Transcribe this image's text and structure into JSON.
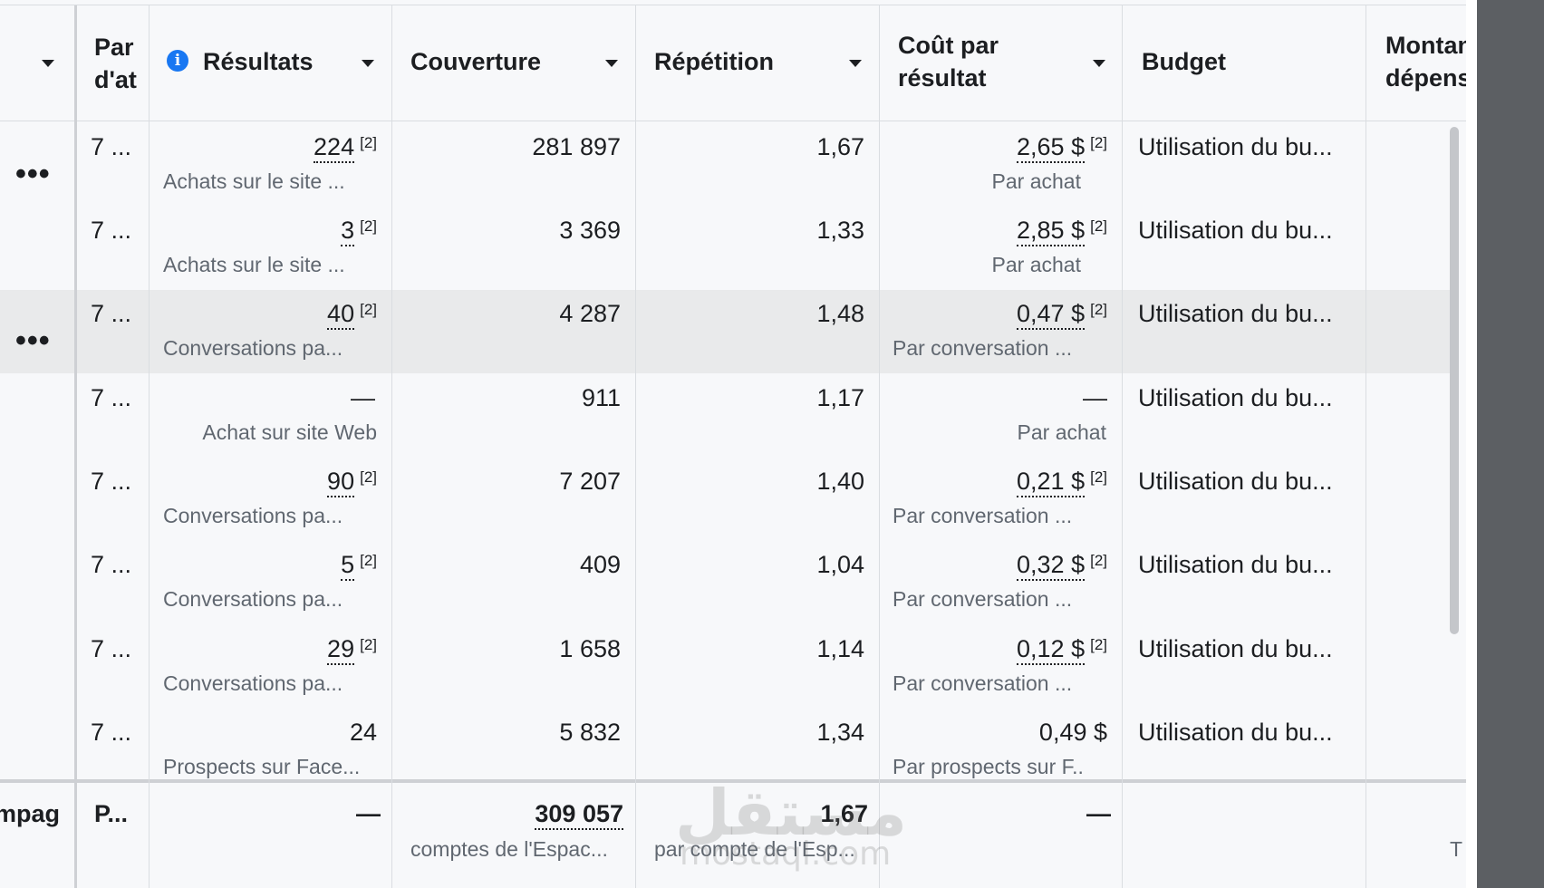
{
  "header": {
    "col0": "",
    "col1_line1": "Par",
    "col1_line2": "d'at",
    "results": "Résultats",
    "reach": "Couverture",
    "frequency": "Répétition",
    "cpr_line1": "Coût par",
    "cpr_line2": "résultat",
    "budget": "Budget",
    "spent_line1": "Montan",
    "spent_line2": "dépens"
  },
  "rows": [
    {
      "par": "7 ...",
      "result": "224",
      "result_note": "[2]",
      "result_label": "Achats sur le site ...",
      "reach": "281 897",
      "frequency": "1,67",
      "cost": "2,65 $",
      "cost_note": "[2]",
      "cost_label": "Par achat",
      "budget": "Utilisation du bu..."
    },
    {
      "par": "7 ...",
      "result": "3",
      "result_note": "[2]",
      "result_label": "Achats sur le site ...",
      "reach": "3 369",
      "frequency": "1,33",
      "cost": "2,85 $",
      "cost_note": "[2]",
      "cost_label": "Par achat",
      "budget": "Utilisation du bu..."
    },
    {
      "par": "7 ...",
      "result": "40",
      "result_note": "[2]",
      "result_label": "Conversations pa...",
      "reach": "4 287",
      "frequency": "1,48",
      "cost": "0,47 $",
      "cost_note": "[2]",
      "cost_label": "Par conversation ...",
      "budget": "Utilisation du bu..."
    },
    {
      "par": "7 ...",
      "result": "—",
      "result_note": "",
      "result_label": "Achat sur site Web",
      "reach": "911",
      "frequency": "1,17",
      "cost": "—",
      "cost_note": "",
      "cost_label": "Par achat",
      "budget": "Utilisation du bu..."
    },
    {
      "par": "7 ...",
      "result": "90",
      "result_note": "[2]",
      "result_label": "Conversations pa...",
      "reach": "7 207",
      "frequency": "1,40",
      "cost": "0,21 $",
      "cost_note": "[2]",
      "cost_label": "Par conversation ...",
      "budget": "Utilisation du bu..."
    },
    {
      "par": "7 ...",
      "result": "5",
      "result_note": "[2]",
      "result_label": "Conversations pa...",
      "reach": "409",
      "frequency": "1,04",
      "cost": "0,32 $",
      "cost_note": "[2]",
      "cost_label": "Par conversation ...",
      "budget": "Utilisation du bu..."
    },
    {
      "par": "7 ...",
      "result": "29",
      "result_note": "[2]",
      "result_label": "Conversations pa...",
      "reach": "1 658",
      "frequency": "1,14",
      "cost": "0,12 $",
      "cost_note": "[2]",
      "cost_label": "Par conversation ...",
      "budget": "Utilisation du bu..."
    },
    {
      "par": "7 ...",
      "result": "24",
      "result_note": "",
      "result_label": "Prospects sur Face...",
      "reach": "5 832",
      "frequency": "1,34",
      "cost": "0,49 $",
      "cost_note": "",
      "cost_label": "Par prospects sur F...",
      "budget": "Utilisation du bu..."
    }
  ],
  "footer": {
    "name": "mpag",
    "par": "P...",
    "result": "—",
    "reach": "309 057",
    "reach_label": "comptes de l'Espac...",
    "frequency": "1,67",
    "frequency_label": "par compte de l'Esp...",
    "cost": "—",
    "spent_partial": "T"
  },
  "watermark": {
    "arabic": "مستقل",
    "latin": "mostaql.com"
  },
  "colors": {
    "accent": "#1877f2",
    "highlight_row": "#e9eaeb",
    "background": "#f7f8fa"
  }
}
